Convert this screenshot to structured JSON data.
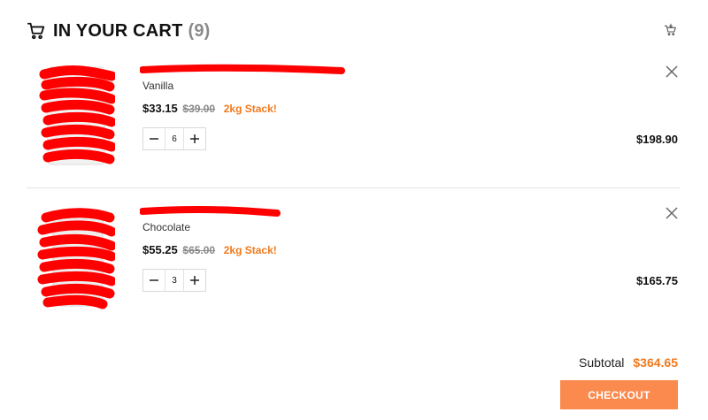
{
  "header": {
    "title": "IN YOUR CART",
    "count": "(9)",
    "cart_icon": "cart-icon",
    "mini_cart_icon": "cart-small-icon"
  },
  "items": [
    {
      "flavor": "Vanilla",
      "price": "$33.15",
      "old_price": "$39.00",
      "promo": "2kg Stack!",
      "quantity": "6",
      "line_total": "$198.90"
    },
    {
      "flavor": "Chocolate",
      "price": "$55.25",
      "old_price": "$65.00",
      "promo": "2kg Stack!",
      "quantity": "3",
      "line_total": "$165.75"
    }
  ],
  "summary": {
    "subtotal_label": "Subtotal",
    "subtotal_amount": "$364.65",
    "checkout_label": "CHECKOUT"
  },
  "colors": {
    "accent": "#f07a1e",
    "checkout_bg": "#fb8a4e",
    "redaction": "#ff0000"
  }
}
